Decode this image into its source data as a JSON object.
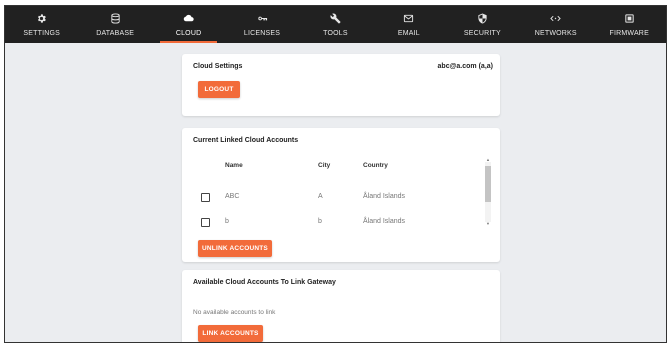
{
  "nav": [
    {
      "label": "SETTINGS",
      "icon": "gear-icon",
      "active": false
    },
    {
      "label": "DATABASE",
      "icon": "database-icon",
      "active": false
    },
    {
      "label": "CLOUD",
      "icon": "cloud-icon",
      "active": true
    },
    {
      "label": "LICENSES",
      "icon": "key-icon",
      "active": false
    },
    {
      "label": "TOOLS",
      "icon": "wrench-icon",
      "active": false
    },
    {
      "label": "EMAIL",
      "icon": "envelope-icon",
      "active": false
    },
    {
      "label": "SECURITY",
      "icon": "shield-icon",
      "active": false
    },
    {
      "label": "NETWORKS",
      "icon": "code-arrows-icon",
      "active": false
    },
    {
      "label": "FIRMWARE",
      "icon": "chip-icon",
      "active": false
    }
  ],
  "cloud_settings": {
    "title": "Cloud Settings",
    "user": "abc@a.com (a,a)",
    "logout_label": "LOGOUT"
  },
  "linked": {
    "title": "Current Linked Cloud Accounts",
    "columns": {
      "name": "Name",
      "city": "City",
      "country": "Country"
    },
    "rows": [
      {
        "name": "ABC",
        "city": "A",
        "country": "Åland Islands"
      },
      {
        "name": "b",
        "city": "b",
        "country": "Åland Islands"
      }
    ],
    "unlink_label": "UNLINK ACCOUNTS"
  },
  "available": {
    "title": "Available Cloud Accounts To Link Gateway",
    "empty_text": "No available accounts to link",
    "link_label": "LINK ACCOUNTS"
  },
  "colors": {
    "accent": "#f26b3a",
    "nav_bg": "#212121",
    "page_bg": "#ebedf0"
  }
}
